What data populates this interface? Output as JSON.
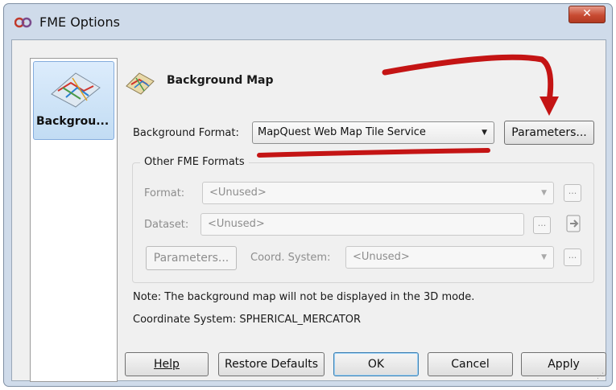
{
  "window": {
    "title": "FME Options",
    "close_glyph": "✕"
  },
  "sidebar": {
    "items": [
      {
        "label": "Backgrou...",
        "icon": "map-icon"
      }
    ]
  },
  "section": {
    "title": "Background Map",
    "icon": "map-icon"
  },
  "background_format": {
    "label": "Background Format:",
    "value": "MapQuest Web Map Tile Service",
    "parameters_label": "Parameters..."
  },
  "other_formats": {
    "title": "Other FME Formats",
    "format_label": "Format:",
    "format_value": "<Unused>",
    "dataset_label": "Dataset:",
    "dataset_value": "<Unused>",
    "parameters_label": "Parameters...",
    "coord_label": "Coord. System:",
    "coord_value": "<Unused>",
    "browse_glyph": "..."
  },
  "notes": {
    "note": "Note: The background map will not be displayed in the 3D mode.",
    "coord": "Coordinate System: SPHERICAL_MERCATOR"
  },
  "buttons": {
    "help": "Help",
    "restore": "Restore Defaults",
    "ok": "OK",
    "cancel": "Cancel",
    "apply": "Apply"
  },
  "colors": {
    "annotation_red": "#c41414",
    "window_frame": "#cfdbea",
    "selection": "#c2dcf3"
  }
}
